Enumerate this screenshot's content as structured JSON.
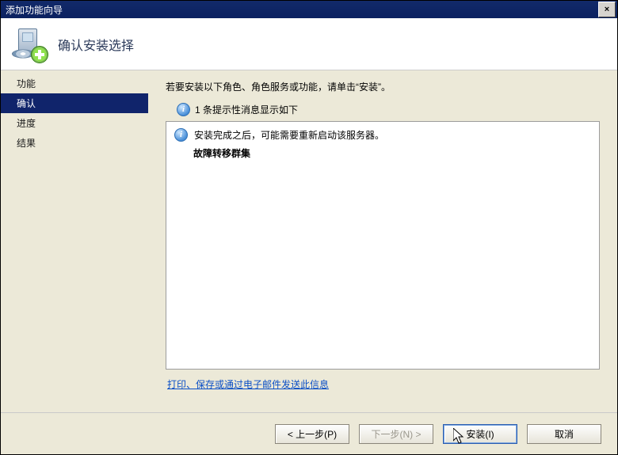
{
  "window": {
    "title": "添加功能向导",
    "close_label": "×"
  },
  "header": {
    "title": "确认安装选择"
  },
  "sidebar": {
    "items": [
      {
        "label": "功能",
        "selected": false
      },
      {
        "label": "确认",
        "selected": true
      },
      {
        "label": "进度",
        "selected": false
      },
      {
        "label": "结果",
        "selected": false
      }
    ]
  },
  "main": {
    "instruction": "若要安装以下角色、角色服务或功能，请单击“安装”。",
    "sub_instruction": "1 条提示性消息显示如下",
    "details": {
      "info_line": "安装完成之后，可能需要重新启动该服务器。",
      "feature_line": "故障转移群集"
    },
    "link": "打印、保存或通过电子邮件发送此信息"
  },
  "footer": {
    "back": "< 上一步(P)",
    "next": "下一步(N) >",
    "install": "安装(I)",
    "cancel": "取消"
  }
}
